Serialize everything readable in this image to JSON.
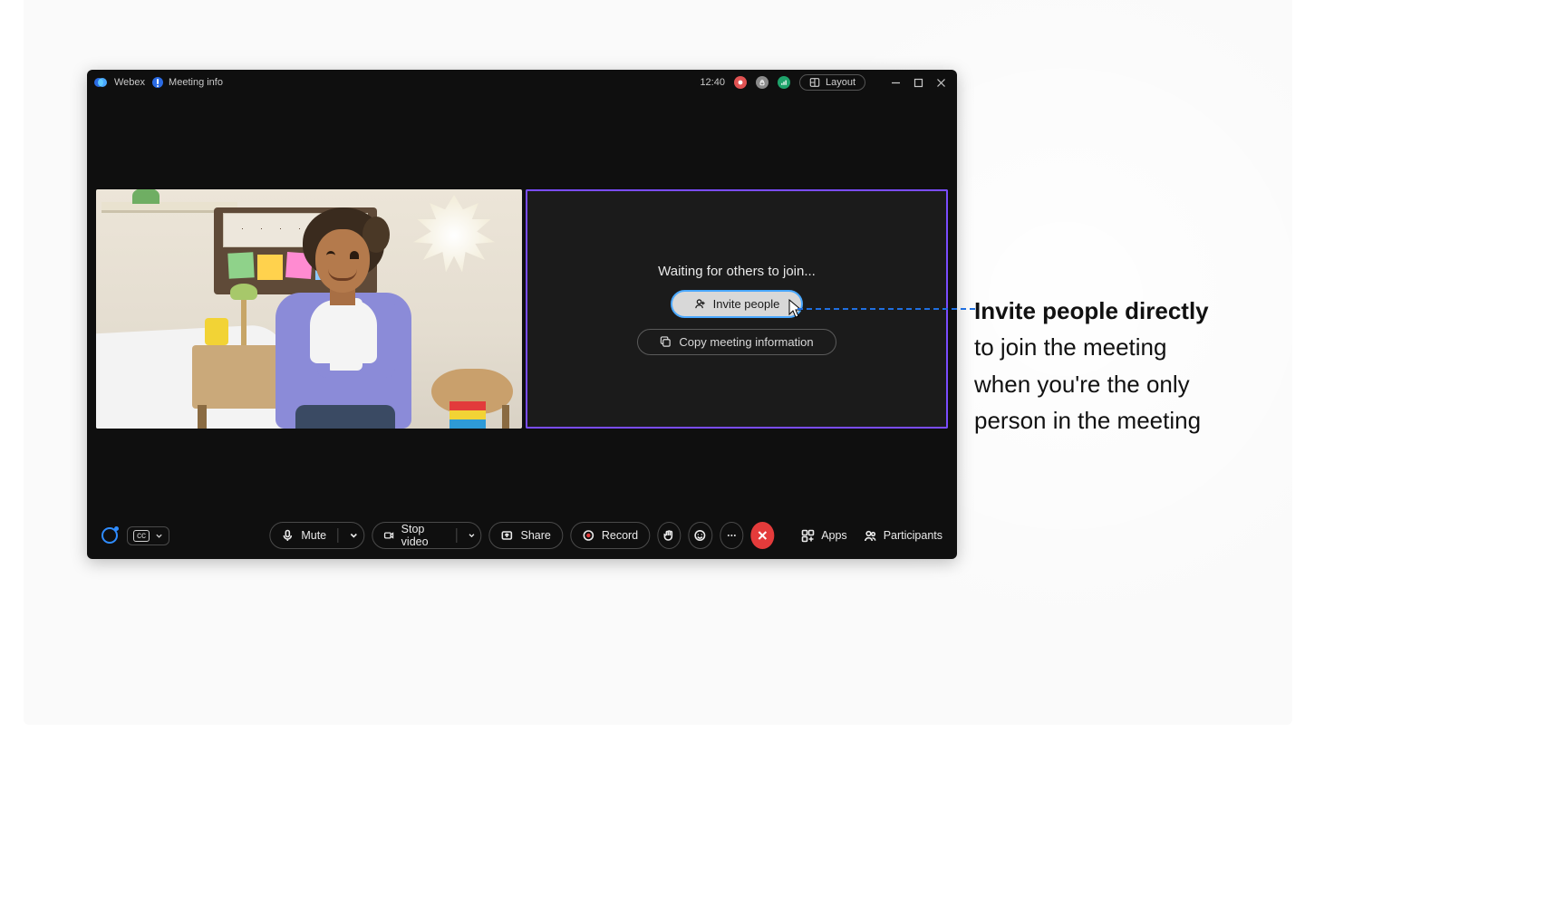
{
  "titlebar": {
    "app_name": "Webex",
    "meeting_info_label": "Meeting info",
    "time": "12:40",
    "layout_label": "Layout"
  },
  "waiting_panel": {
    "message": "Waiting for others to join...",
    "invite_label": "Invite people",
    "copy_label": "Copy meeting information"
  },
  "toolbar": {
    "cc_label": "cc",
    "mute_label": "Mute",
    "stop_video_label": "Stop video",
    "share_label": "Share",
    "record_label": "Record",
    "apps_label": "Apps",
    "participants_label": "Participants"
  },
  "annotation": {
    "bold": "Invite people directly",
    "line1": "to join the meeting",
    "line2": "when you're the only",
    "line3": "person in the meeting"
  }
}
